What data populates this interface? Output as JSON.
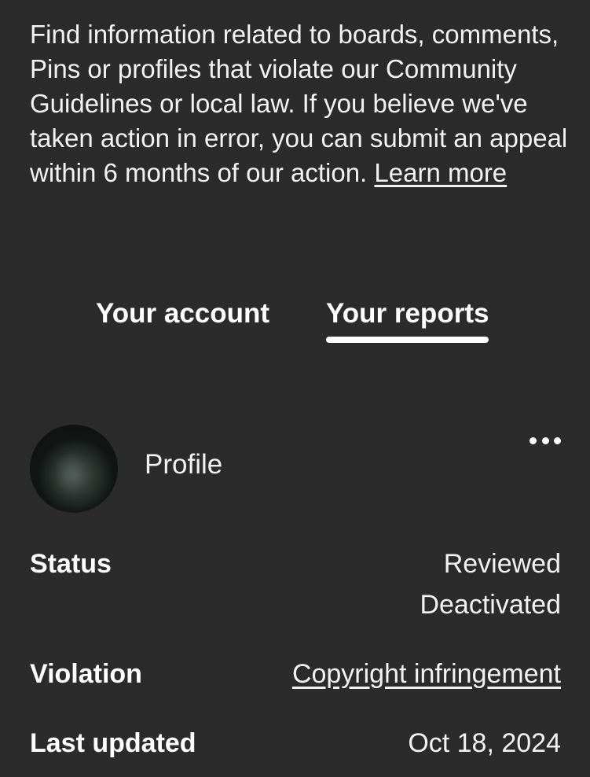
{
  "intro": {
    "text": "Find information related to boards, comments, Pins or profiles that violate our Community Guidelines or local law. If you believe we've taken action in error, you can submit an appeal within 6 months of our action. ",
    "link_label": "Learn more"
  },
  "tabs": [
    {
      "label": "Your account",
      "selected": false
    },
    {
      "label": "Your reports",
      "selected": true
    }
  ],
  "report": {
    "type_label": "Profile",
    "more_icon": "more-horizontal-icon",
    "status": {
      "label": "Status",
      "value_line1": "Reviewed",
      "value_line2": "Deactivated"
    },
    "violation": {
      "label": "Violation",
      "value": "Copyright infringement"
    },
    "last_updated": {
      "label": "Last updated",
      "value": "Oct 18, 2024"
    }
  },
  "colors": {
    "background": "#2b2b2b",
    "text": "#ffffff",
    "tab_indicator": "#ffffff"
  }
}
